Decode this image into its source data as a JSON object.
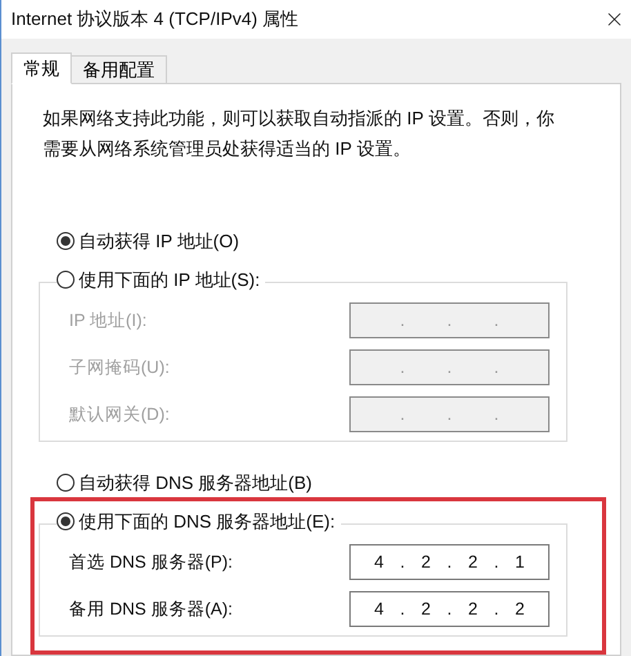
{
  "window": {
    "title": "Internet 协议版本 4 (TCP/IPv4) 属性"
  },
  "tabs": [
    {
      "label": "常规",
      "selected": true
    },
    {
      "label": "备用配置",
      "selected": false
    }
  ],
  "description": "如果网络支持此功能，则可以获取自动指派的 IP 设置。否则，你需要从网络系统管理员处获得适当的 IP 设置。",
  "ip_section": {
    "options": [
      {
        "label": "自动获得 IP 地址(O)",
        "selected": true
      },
      {
        "label": "使用下面的 IP 地址(S):",
        "selected": false
      }
    ],
    "fields": [
      {
        "label": "IP 地址(I):",
        "disabled": true,
        "separators": [
          ".",
          ".",
          "."
        ]
      },
      {
        "label": "子网掩码(U):",
        "disabled": true,
        "separators": [
          ".",
          ".",
          "."
        ]
      },
      {
        "label": "默认网关(D):",
        "disabled": true,
        "separators": [
          ".",
          ".",
          "."
        ]
      }
    ]
  },
  "dns_section": {
    "highlighted": true,
    "options": [
      {
        "label": "自动获得 DNS 服务器地址(B)",
        "selected": false
      },
      {
        "label": "使用下面的 DNS 服务器地址(E):",
        "selected": true
      }
    ],
    "fields": [
      {
        "label": "首选 DNS 服务器(P):",
        "disabled": false,
        "separators": [
          ".",
          ".",
          "."
        ],
        "octets": [
          "4",
          "2",
          "2",
          "1"
        ]
      },
      {
        "label": "备用 DNS 服务器(A):",
        "disabled": false,
        "separators": [
          ".",
          ".",
          "."
        ],
        "octets": [
          "4",
          "2",
          "2",
          "2"
        ]
      }
    ]
  }
}
